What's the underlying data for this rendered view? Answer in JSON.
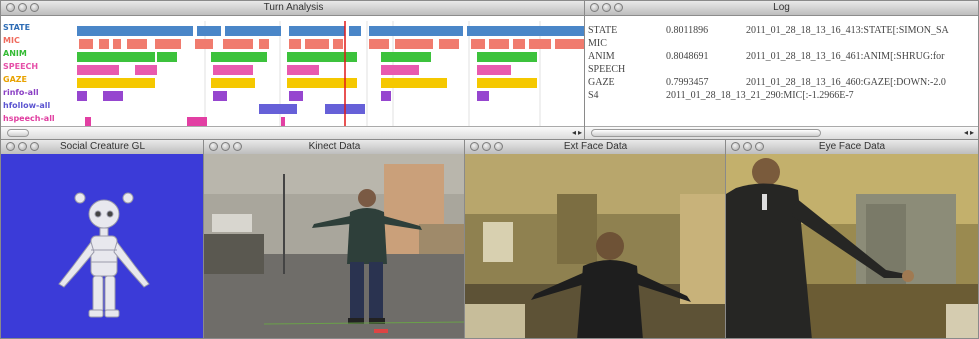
{
  "turn_analysis": {
    "title": "Turn Analysis",
    "tracks": [
      {
        "label": "STATE",
        "color": "#2f6db5"
      },
      {
        "label": "MIC",
        "color": "#ef6b5e"
      },
      {
        "label": "ANIM",
        "color": "#33bb33"
      },
      {
        "label": "SPEECH",
        "color": "#e64fa8"
      },
      {
        "label": "GAZE",
        "color": "#f2c300"
      },
      {
        "label": "rinfo-all",
        "color": "#8a3fc4"
      },
      {
        "label": "hfollow-all",
        "color": "#5c55d1"
      },
      {
        "label": "hspeech-all",
        "color": "#e03ea0"
      }
    ]
  },
  "log": {
    "title": "Log",
    "rows": [
      {
        "name": "STATE",
        "value": "0.8011896",
        "message": "2011_01_28_18_13_16_413:STATE[:SIMON_SA"
      },
      {
        "name": "MIC",
        "value": "",
        "message": ""
      },
      {
        "name": "ANIM",
        "value": "0.8048691",
        "message": "2011_01_28_18_13_16_461:ANIM[:SHRUG:for"
      },
      {
        "name": "SPEECH",
        "value": "",
        "message": ""
      },
      {
        "name": "GAZE",
        "value": "0.7993457",
        "message": "2011_01_28_18_13_16_460:GAZE[:DOWN:-2.0"
      },
      {
        "name": "S4",
        "value": "",
        "message": "2011_01_28_18_13_21_290:MIC[:-1.2966E-7"
      }
    ]
  },
  "social_creature": {
    "title": "Social Creature GL",
    "background": "#3b3bd8"
  },
  "kinect": {
    "title": "Kinect Data"
  },
  "ext_face": {
    "title": "Ext Face Data"
  },
  "eye_face": {
    "title": "Eye Face Data"
  }
}
